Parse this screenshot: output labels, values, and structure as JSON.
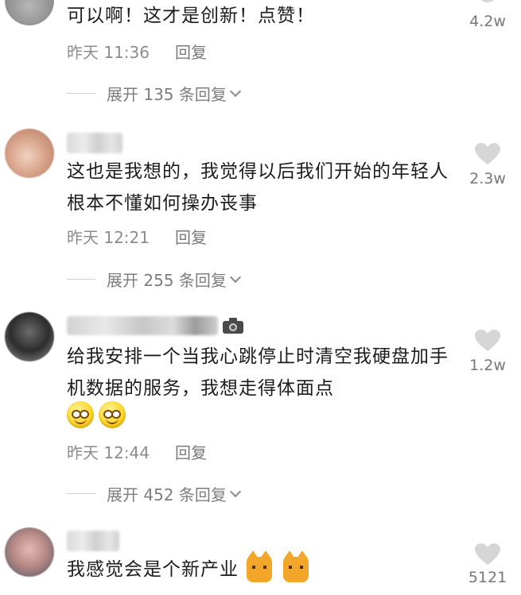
{
  "comments": [
    {
      "text": "可以啊！这才是创新！点赞！",
      "time": "昨天 11:36",
      "reply_label": "回复",
      "expand_label": "展开 135 条回复",
      "likes": "4.2w"
    },
    {
      "text": "这也是我想的，我觉得以后我们开始的年轻人根本不懂如何操办丧事",
      "time": "昨天 12:21",
      "reply_label": "回复",
      "expand_label": "展开 255 条回复",
      "likes": "2.3w"
    },
    {
      "text": "给我安排一个当我心跳停止时清空我硬盘加手机数据的服务，我想走得体面点",
      "time": "昨天 12:44",
      "reply_label": "回复",
      "expand_label": "展开 452 条回复",
      "likes": "1.2w"
    },
    {
      "text": "我感觉会是个新产业",
      "likes": "5121"
    }
  ],
  "icons": {
    "heart": "heart-icon",
    "chevron": "chevron-down-icon",
    "camera": "camera-icon",
    "emoji_grin": "grin-emoji-icon",
    "emoji_cat": "cat-emoji-icon"
  },
  "colors": {
    "text": "#1c1c1c",
    "meta": "#8c8c8c",
    "heart": "#d6d6d6"
  }
}
